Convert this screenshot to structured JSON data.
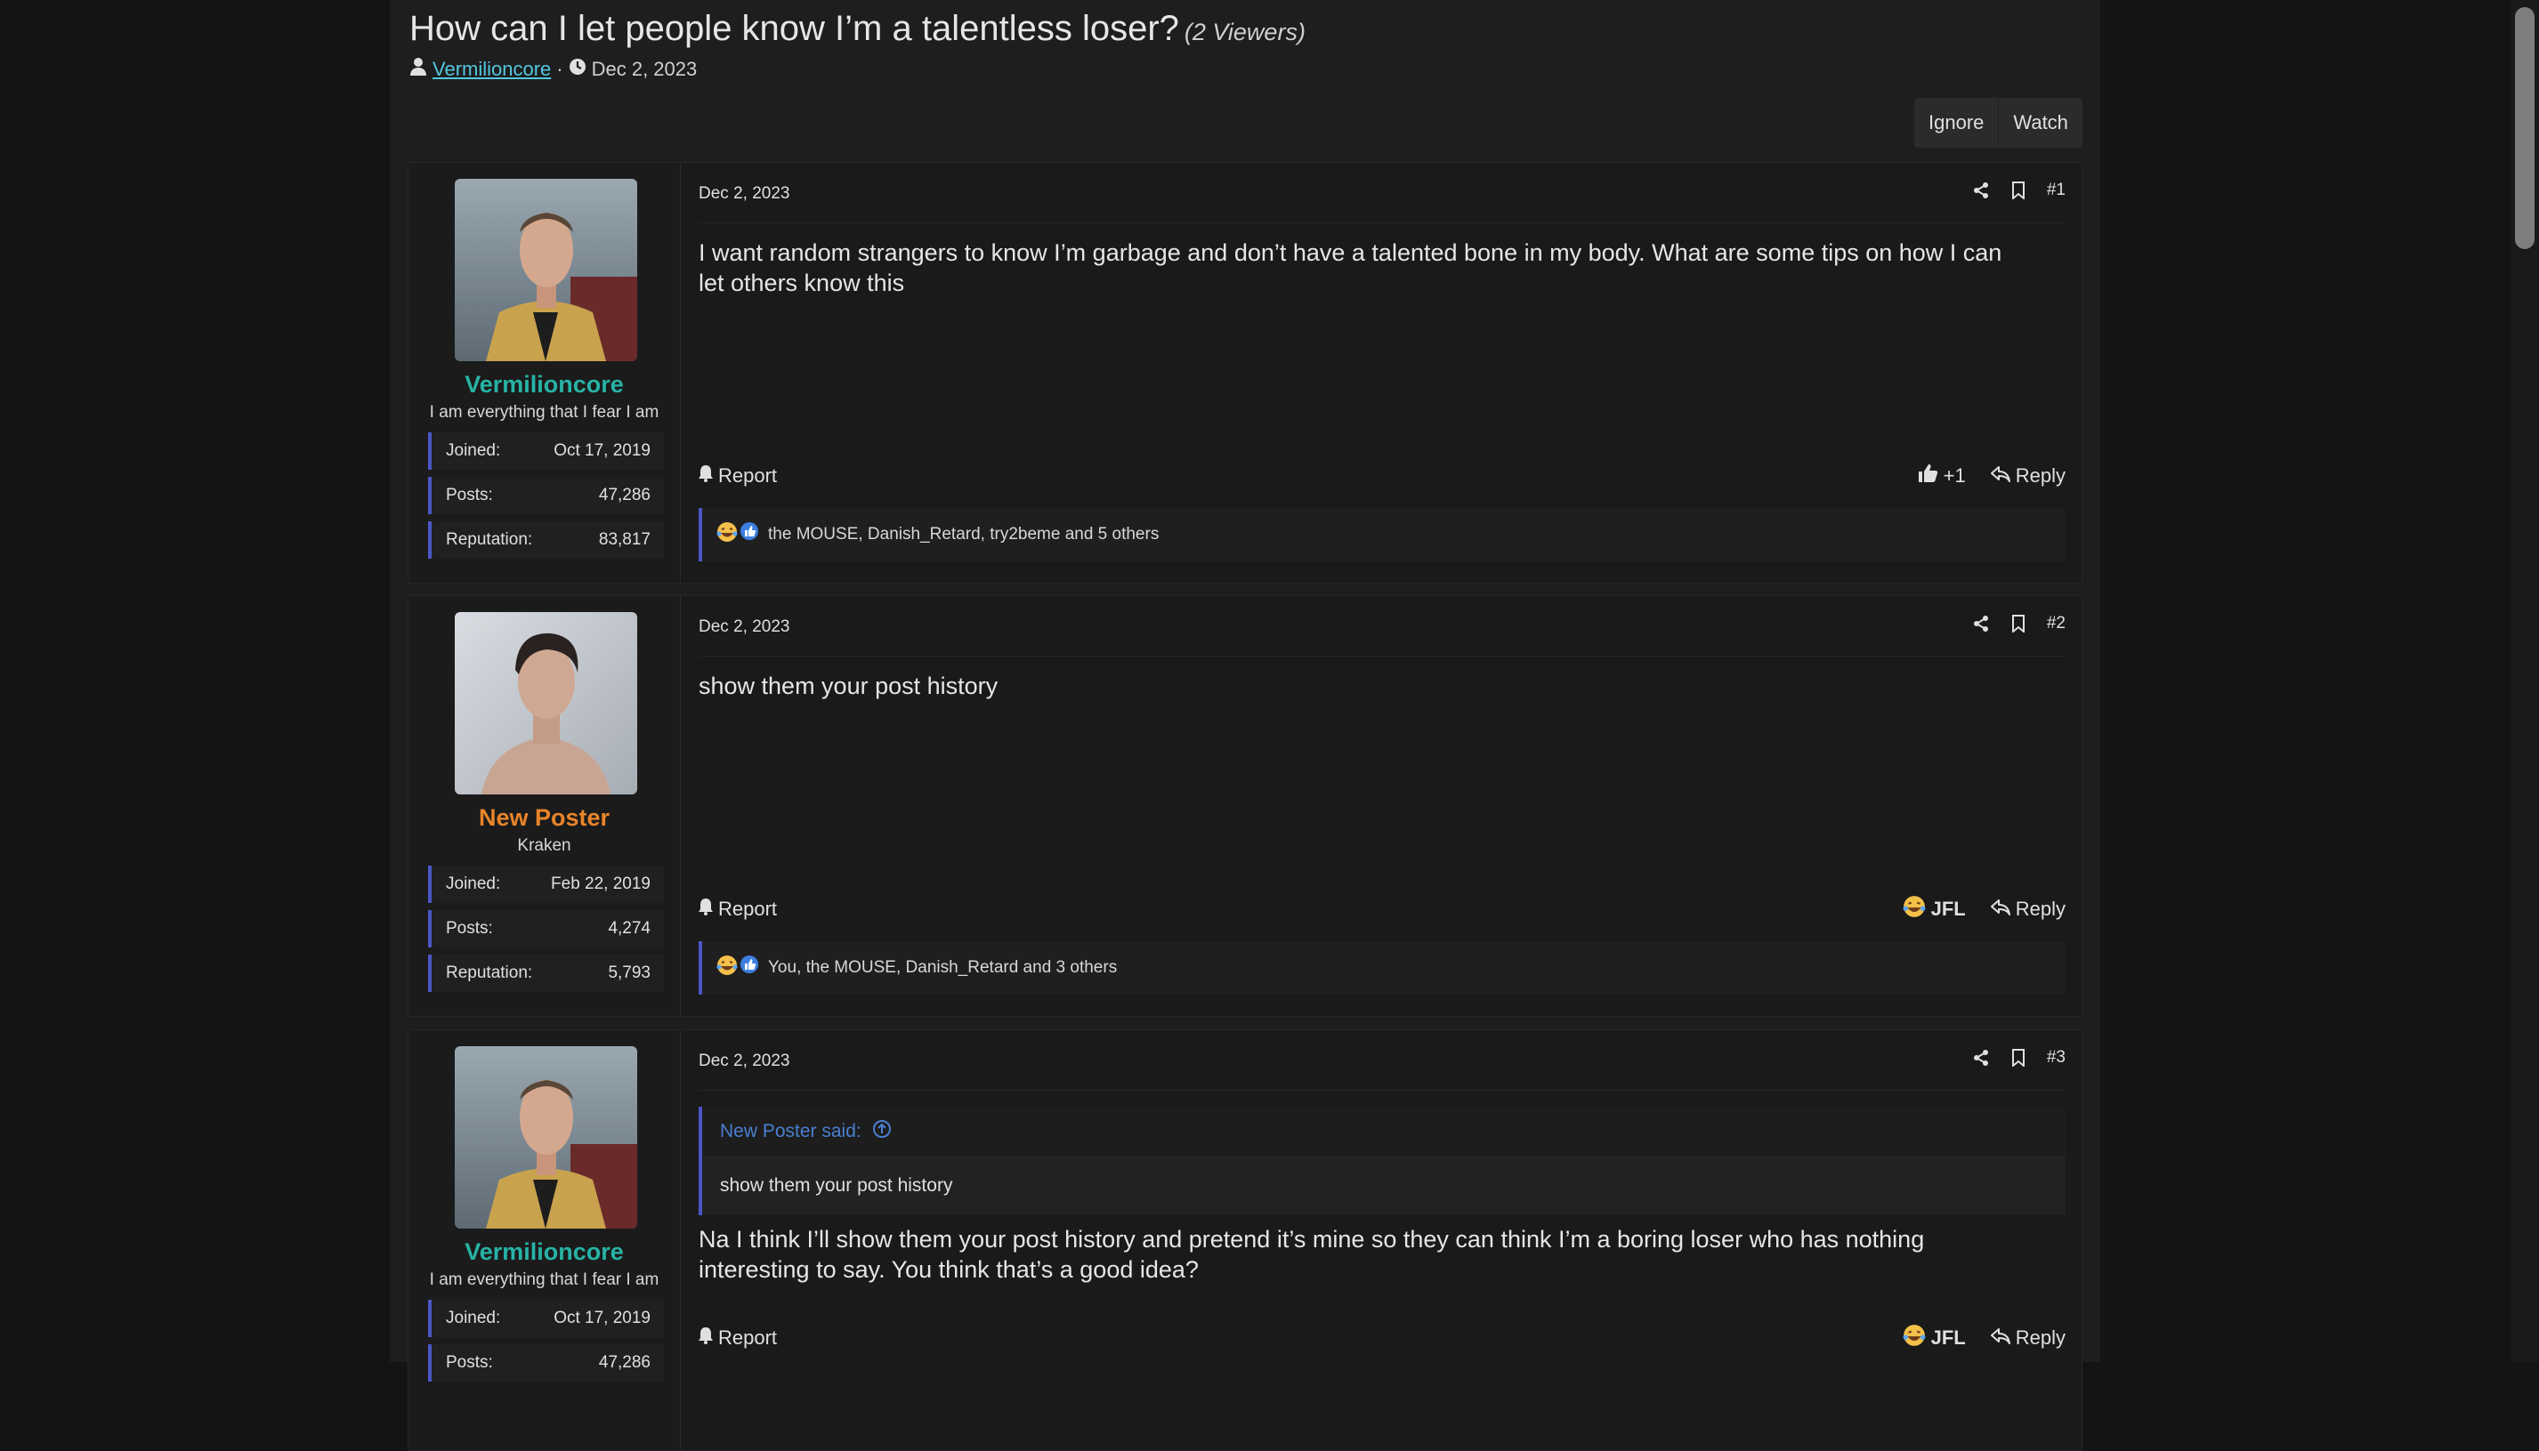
{
  "thread": {
    "title": "How can I let people know I’m a talentless loser?",
    "viewers": "(2 Viewers)",
    "author": "Vermilioncore",
    "separator": "·",
    "date": "Dec 2, 2023"
  },
  "actions": {
    "ignore": "Ignore",
    "watch": "Watch"
  },
  "posts": [
    {
      "date": "Dec 2, 2023",
      "number": "#1",
      "username": "Vermilioncore",
      "username_color": "#27b3a5",
      "user_title": "I am everything that I fear I am",
      "stats": [
        {
          "label": "Joined:",
          "value": "Oct 17, 2019"
        },
        {
          "label": "Posts:",
          "value": "47,286"
        },
        {
          "label": "Reputation:",
          "value": "83,817"
        }
      ],
      "body": "I want random strangers to know I’m garbage and don’t have a talented bone in my body. What are some tips on how I can let others know this",
      "report": "Report",
      "reaction_label": "+1",
      "reply": "Reply",
      "reactions_text": "the MOUSE, Danish_Retard, try2beme and 5 others"
    },
    {
      "date": "Dec 2, 2023",
      "number": "#2",
      "username": "New Poster",
      "username_color": "#e8842a",
      "user_title": "Kraken",
      "stats": [
        {
          "label": "Joined:",
          "value": "Feb 22, 2019"
        },
        {
          "label": "Posts:",
          "value": "4,274"
        },
        {
          "label": "Reputation:",
          "value": "5,793"
        }
      ],
      "body": "show them your post history",
      "report": "Report",
      "reaction_label": "JFL",
      "reply": "Reply",
      "reactions_text": "You, the MOUSE, Danish_Retard and 3 others"
    },
    {
      "date": "Dec 2, 2023",
      "number": "#3",
      "username": "Vermilioncore",
      "username_color": "#27b3a5",
      "user_title": "I am everything that I fear I am",
      "stats": [
        {
          "label": "Joined:",
          "value": "Oct 17, 2019"
        },
        {
          "label": "Posts:",
          "value": "47,286"
        }
      ],
      "quote_author": "New Poster said:",
      "quote_text": "show them your post history",
      "body": "Na I think I’ll show them your post history and pretend it’s mine so they can think I’m a boring loser who has nothing interesting to say. You think that’s a good idea?",
      "report": "Report",
      "reaction_label": "JFL",
      "reply": "Reply"
    }
  ],
  "icons": {
    "user": "user-icon",
    "clock": "clock-icon",
    "share": "share-icon",
    "bookmark": "bookmark-icon",
    "bell": "bell-icon",
    "thumbs_up": "thumbs-up-icon",
    "reply": "reply-icon",
    "laugh": "laughing-emoji-icon",
    "like": "like-badge-icon",
    "arrow_up": "arrow-up-circle-icon"
  },
  "colors": {
    "accent": "#4a56c7",
    "link": "#52c7e0",
    "background": "#1e1e1e"
  }
}
